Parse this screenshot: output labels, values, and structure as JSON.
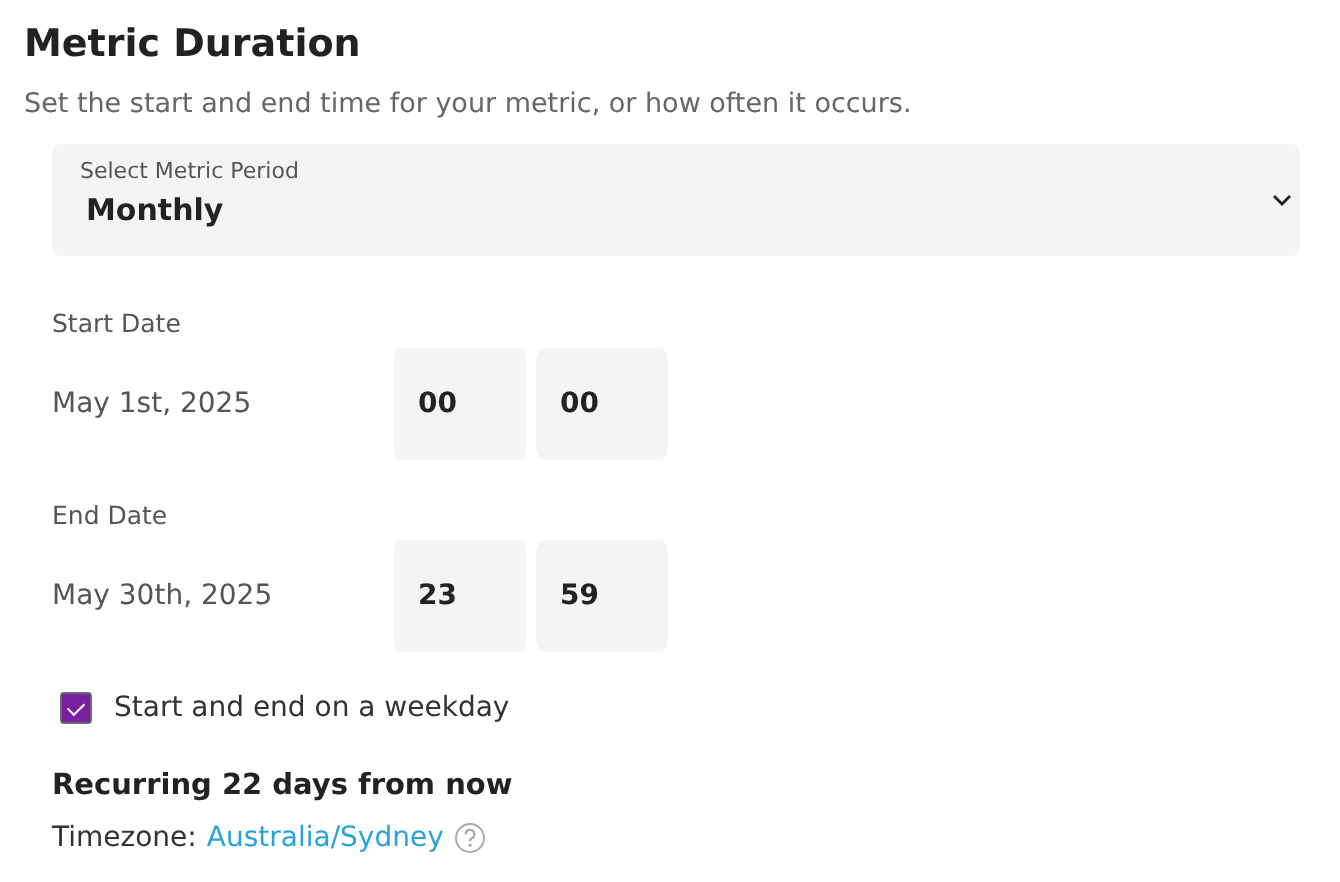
{
  "title": "Metric Duration",
  "description": "Set the start and end time for your metric, or how often it occurs.",
  "period_select": {
    "label": "Select Metric Period",
    "value": "Monthly"
  },
  "dates": [
    {
      "label": "Start Date",
      "date": "May 1st, 2025",
      "hour": "00",
      "minute": "00"
    },
    {
      "label": "End Date",
      "date": "May 30th, 2025",
      "hour": "23",
      "minute": "59"
    }
  ],
  "weekday_option": {
    "label": "Start and end on a weekday",
    "checked": true
  },
  "recurrence": "Recurring 22 days from now",
  "timezone": {
    "label": "Timezone:",
    "value": "Australia/Sydney"
  }
}
